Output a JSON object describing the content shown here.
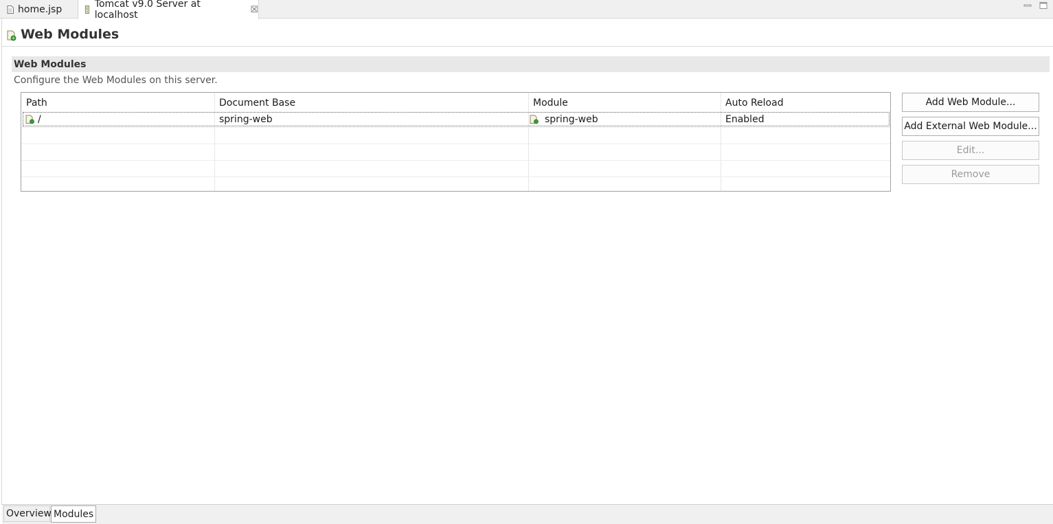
{
  "editor_tabs": [
    {
      "label": "home.jsp",
      "icon": "file-icon"
    },
    {
      "label": "Tomcat v9.0 Server at localhost",
      "icon": "server-icon",
      "close": "☒"
    }
  ],
  "window_controls": {
    "minimize": "minimize-icon",
    "maximize": "maximize-icon"
  },
  "page": {
    "title": "Web Modules",
    "icon": "web-module-icon"
  },
  "section": {
    "title": "Web Modules",
    "description": "Configure the Web Modules on this server."
  },
  "table": {
    "columns": [
      "Path",
      "Document Base",
      "Module",
      "Auto Reload"
    ],
    "rows": [
      {
        "path": "/",
        "document_base": "spring-web",
        "module": "spring-web",
        "auto_reload": "Enabled"
      }
    ]
  },
  "buttons": {
    "add_web_module": "Add Web Module...",
    "add_external_web_module": "Add External Web Module...",
    "edit": "Edit...",
    "remove": "Remove"
  },
  "page_tabs": [
    "Overview",
    "Modules"
  ],
  "colors": {
    "section_bar": "#e8e8e8",
    "accent_green": "#3a9a3a"
  }
}
